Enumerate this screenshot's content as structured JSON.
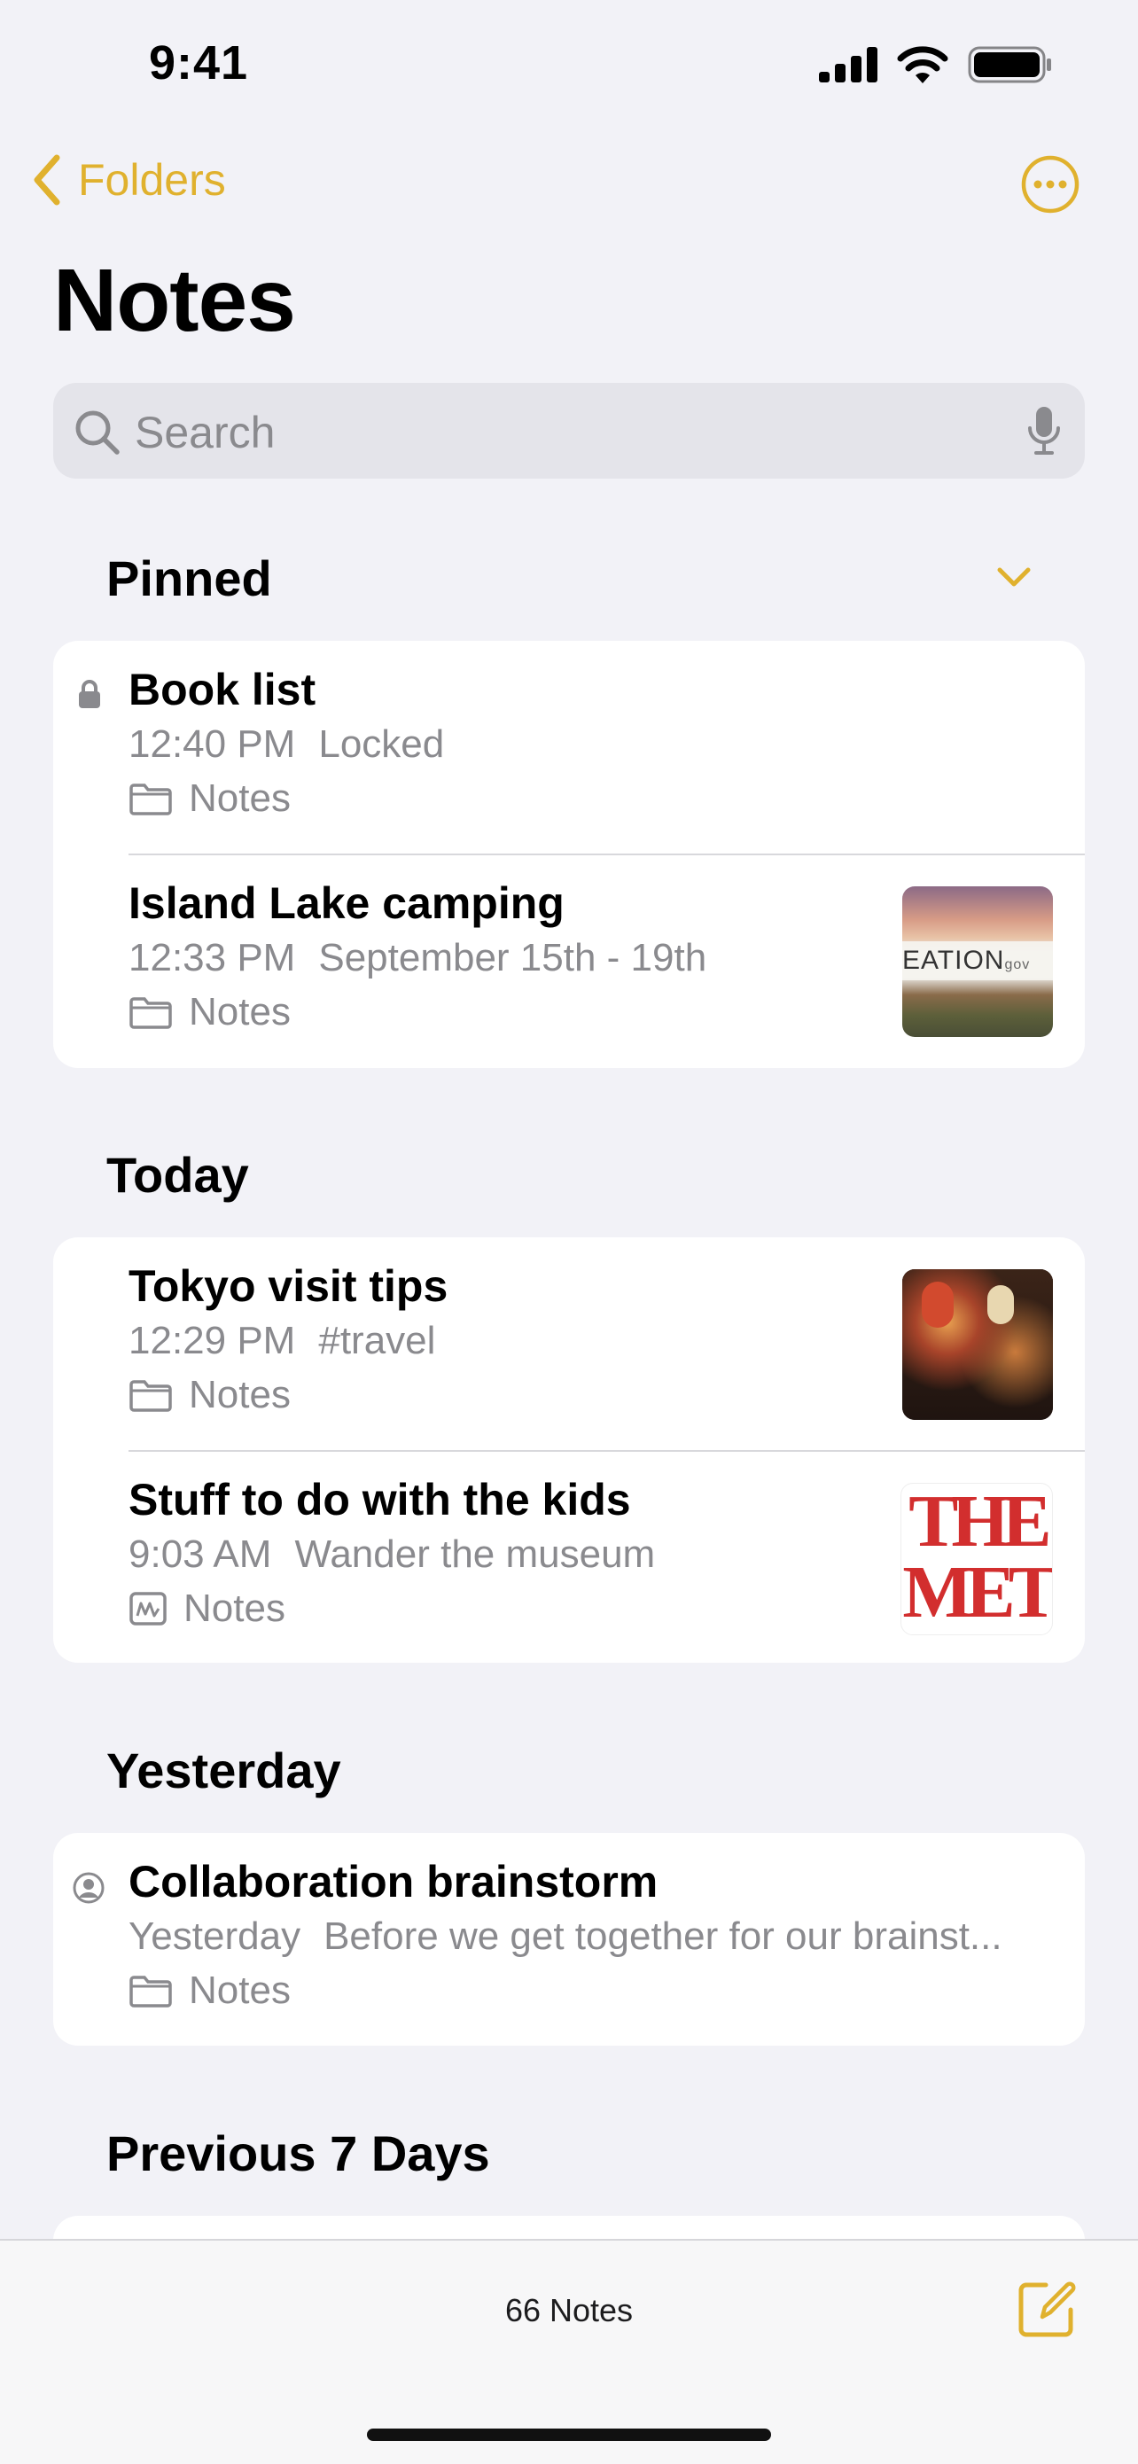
{
  "status_bar": {
    "time": "9:41"
  },
  "nav": {
    "back_label": "Folders",
    "more_icon": "ellipsis-circle-icon"
  },
  "page": {
    "title": "Notes"
  },
  "search": {
    "placeholder": "Search"
  },
  "sections": {
    "pinned": {
      "header": "Pinned",
      "notes": [
        {
          "title": "Book list",
          "time": "12:40 PM",
          "preview": "Locked",
          "folder": "Notes",
          "lead_icon": "lock-icon"
        },
        {
          "title": "Island Lake camping",
          "time": "12:33 PM",
          "preview": "September 15th - 19th",
          "folder": "Notes",
          "thumbnail_text": "EATION",
          "thumbnail_suffix": "gov"
        }
      ]
    },
    "today": {
      "header": "Today",
      "notes": [
        {
          "title": "Tokyo visit tips",
          "time": "12:29 PM",
          "preview": "#travel",
          "folder": "Notes"
        },
        {
          "title": "Stuff to do with the kids",
          "time": "9:03 AM",
          "preview": "Wander the museum",
          "folder": "Notes",
          "thumbnail_line1": "THE",
          "thumbnail_line2": "MET"
        }
      ]
    },
    "yesterday": {
      "header": "Yesterday",
      "notes": [
        {
          "title": "Collaboration brainstorm",
          "time": "Yesterday",
          "preview": "Before we get together for our brainst...",
          "folder": "Notes",
          "lead_icon": "shared-person-icon"
        }
      ]
    },
    "previous": {
      "header": "Previous 7 Days"
    }
  },
  "bottom_bar": {
    "count": "66 Notes"
  },
  "colors": {
    "accent": "#E0B12E",
    "background": "#F2F2F7",
    "secondary_text": "#8A8A8E"
  }
}
